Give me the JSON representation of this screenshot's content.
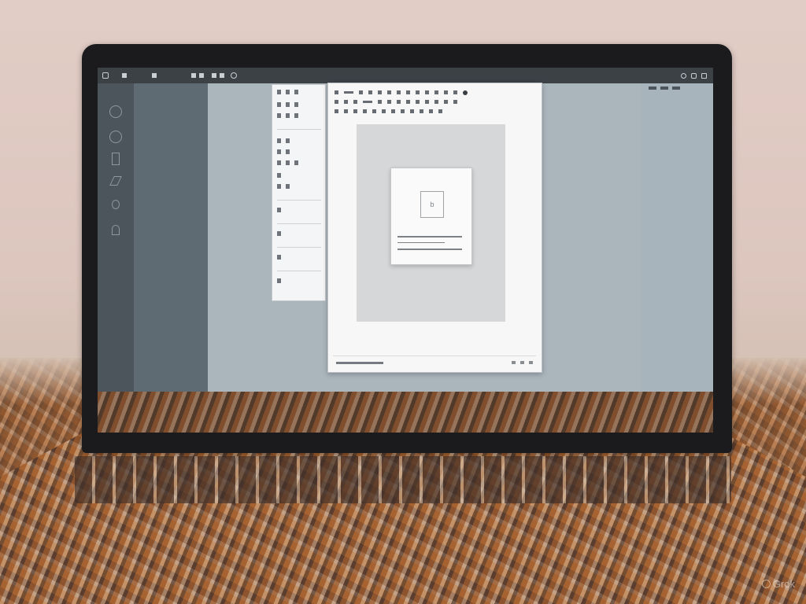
{
  "colors": {
    "wall": "#e2cdc6",
    "bezel": "#1b1b1d",
    "menubar": "#3c4146",
    "dock": "#4c555b",
    "desktop_light": "#aab5bc",
    "document_bg": "#f7f7f8",
    "canvas": "#d6d7d8"
  },
  "menubar": {
    "app_label": "",
    "icons": [
      "apple-icon",
      "file-icon",
      "edit-icon",
      "view-icon",
      "window-icon",
      "help-icon"
    ],
    "status_icons": [
      "search-icon",
      "wifi-icon",
      "battery-icon"
    ]
  },
  "dock": {
    "items": [
      {
        "icon": "circle-tool-icon"
      },
      {
        "icon": "ring-tool-icon"
      },
      {
        "icon": "book-icon"
      },
      {
        "icon": "pen-icon"
      },
      {
        "icon": "brush-icon"
      },
      {
        "icon": "lock-icon"
      }
    ]
  },
  "palette": {
    "rows": 9
  },
  "document": {
    "toolbar_rows": 3,
    "card": {
      "image_glyph": "b"
    },
    "status_text": ""
  },
  "watermark": {
    "text": "Grok"
  }
}
